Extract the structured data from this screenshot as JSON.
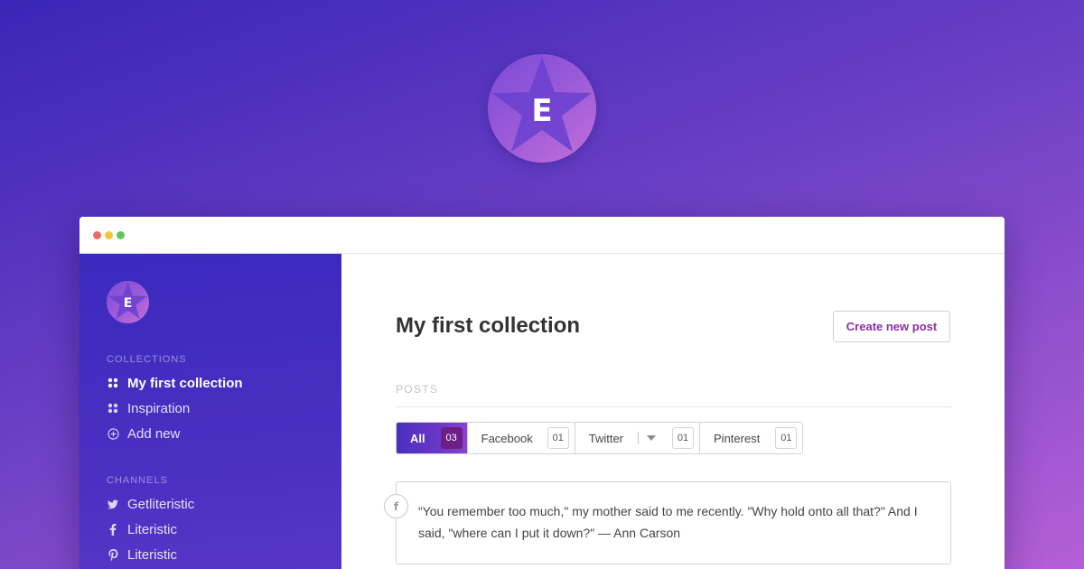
{
  "brand": {
    "logo_letter": "E"
  },
  "window": {
    "controls": [
      "close",
      "minimize",
      "maximize"
    ]
  },
  "sidebar": {
    "logo_letter": "E",
    "collections_heading": "COLLECTIONS",
    "collections": [
      {
        "label": "My first collection",
        "icon": "grid-dots-icon",
        "active": true
      },
      {
        "label": "Inspiration",
        "icon": "grid-dots-icon",
        "active": false
      },
      {
        "label": "Add new",
        "icon": "plus-circle-icon",
        "active": false
      }
    ],
    "channels_heading": "CHANNELS",
    "channels": [
      {
        "label": "Getliteristic",
        "icon": "twitter-icon"
      },
      {
        "label": "Literistic",
        "icon": "facebook-icon"
      },
      {
        "label": "Literistic",
        "icon": "pinterest-icon"
      }
    ]
  },
  "main": {
    "title": "My first collection",
    "create_button": "Create new post",
    "posts_label": "POSTS",
    "tabs": [
      {
        "label": "All",
        "count": "03",
        "active": true
      },
      {
        "label": "Facebook",
        "count": "01",
        "active": false
      },
      {
        "label": "Twitter",
        "count": "01",
        "active": false
      },
      {
        "label": "Pinterest",
        "count": "01",
        "active": false
      }
    ],
    "post": {
      "network_icon": "f",
      "text": "“You remember too much,\" my mother said to me recently. \"Why hold onto all that?\" And I said, \"where can I put it down?\" — Ann Carson"
    }
  },
  "colors": {
    "accent": "#8b2fa3",
    "sidebar_bg": "#3b29bd",
    "active_tab": "#4a2ec0",
    "active_count": "#6d1f86"
  }
}
